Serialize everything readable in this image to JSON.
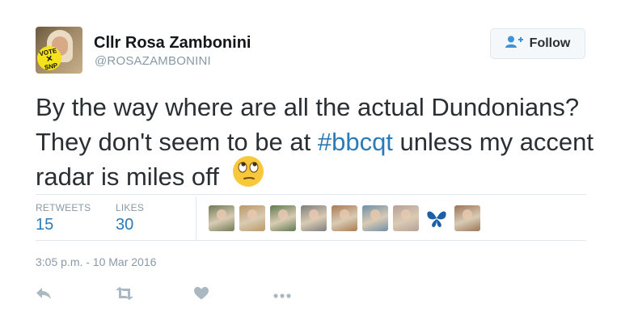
{
  "author": {
    "display_name": "Cllr Rosa Zambonini",
    "handle": "@ROSAZAMBONINI",
    "avatar_badge_line1": "VOTE",
    "avatar_badge_line2": "SNP"
  },
  "follow_button": {
    "label": "Follow",
    "icon": "add-user-icon"
  },
  "tweet": {
    "text_part1": "By the way where are all the actual Dundonians? They don't seem to be at ",
    "hashtag": "#bbcqt",
    "text_part2": " unless my accent radar is miles off",
    "emoji": "face-with-rolling-eyes"
  },
  "stats": {
    "retweets_label": "RETWEETS",
    "retweets_value": "15",
    "likes_label": "LIKES",
    "likes_value": "30"
  },
  "likers": [
    {
      "name": "liker-avatar-1",
      "color": "#6f7a55"
    },
    {
      "name": "liker-avatar-2",
      "color": "#b89868"
    },
    {
      "name": "liker-avatar-3",
      "color": "#5e7a4e"
    },
    {
      "name": "liker-avatar-4",
      "color": "#7d7d7d"
    },
    {
      "name": "liker-avatar-5",
      "color": "#a87a52"
    },
    {
      "name": "liker-avatar-6",
      "color": "#6e8fa6"
    },
    {
      "name": "liker-avatar-7",
      "color": "#b8a098"
    },
    {
      "name": "liker-avatar-8",
      "color": "#1b5fa8"
    },
    {
      "name": "liker-avatar-9",
      "color": "#9a7458"
    }
  ],
  "timestamp": "3:05 p.m. - 10 Mar 2016",
  "actions": [
    {
      "name": "reply-button",
      "icon": "reply-icon"
    },
    {
      "name": "retweet-button",
      "icon": "retweet-icon"
    },
    {
      "name": "like-button",
      "icon": "heart-icon"
    },
    {
      "name": "more-button",
      "icon": "more-icon"
    }
  ],
  "colors": {
    "link": "#2b7bb9",
    "muted": "#8899a6",
    "text": "#292f33",
    "divider": "#e1e8ed"
  }
}
